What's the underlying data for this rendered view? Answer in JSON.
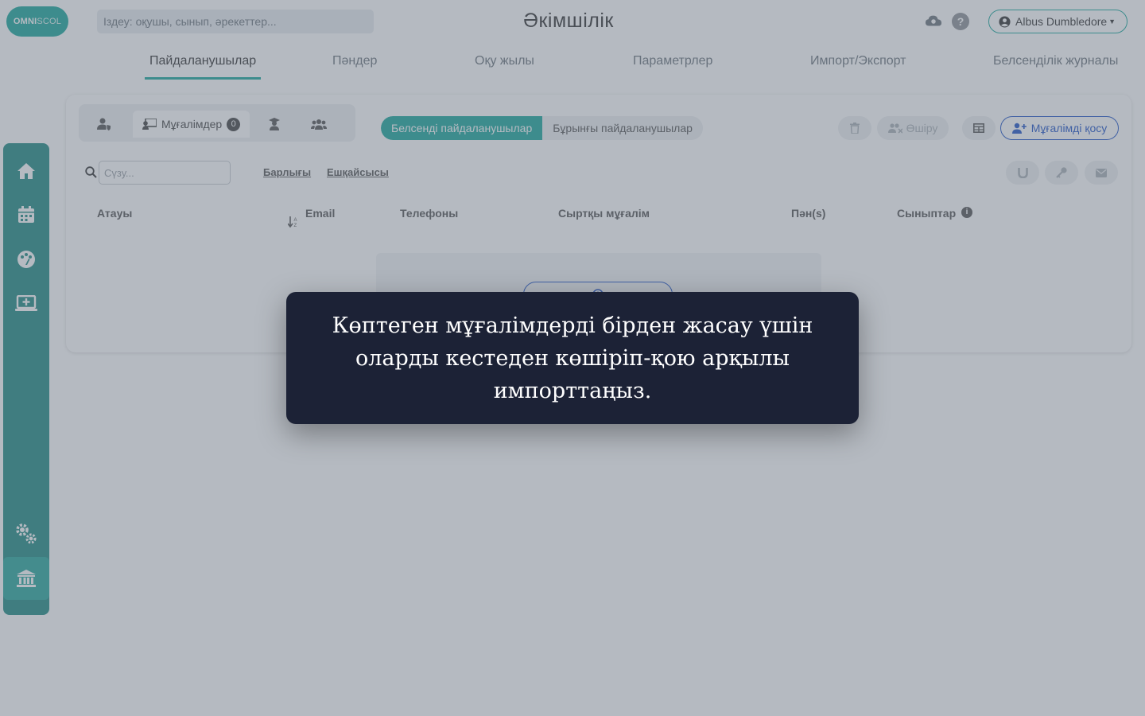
{
  "app": {
    "logo_text_bold": "OMNI",
    "logo_text_light": "SCOL",
    "page_title": "Әкімшілік",
    "search_placeholder": "Іздеу: оқушы, сынып, әрекеттер...",
    "user_name": "Albus Dumbledore"
  },
  "main_tabs": [
    {
      "label": "Пайдаланушылар",
      "active": true
    },
    {
      "label": "Пәндер",
      "active": false
    },
    {
      "label": "Оқу жылы",
      "active": false
    },
    {
      "label": "Параметрлер",
      "active": false
    },
    {
      "label": "Импорт/Экспорт",
      "active": false
    },
    {
      "label": "Белсенділік журналы",
      "active": false
    }
  ],
  "sidebar": {
    "items": [
      {
        "icon": "home-icon"
      },
      {
        "icon": "calendar-icon"
      },
      {
        "icon": "palette-icon"
      },
      {
        "icon": "laptop-icon"
      },
      {
        "icon": "cogs-icon"
      },
      {
        "icon": "institution-icon",
        "active": true
      }
    ]
  },
  "users": {
    "role_tabs": {
      "teachers_label": "Мұғалімдер",
      "teachers_count": "0"
    },
    "status_toggle": {
      "active_label": "Белсенді пайдаланушылар",
      "former_label": "Бұрынғы пайдаланушылар"
    },
    "delete_label": "Өшіру",
    "add_teacher_label": "Мұғалімді қосу",
    "filter_placeholder": "Сүзу...",
    "filter_all": "Барлығы",
    "filter_none": "Ешқайсысы",
    "columns": {
      "name": "Атауы",
      "email": "Email",
      "phone": "Телефоны",
      "external_teacher": "Сыртқы мұғалім",
      "subjects": "Пән(s)",
      "classes": "Сыныптар"
    }
  },
  "tooltip": {
    "text": "Көптеген мұғалімдерді бірден жасау үшін оларды кестеден көшіріп-қою арқылы импорттаңыз."
  },
  "colors": {
    "brand": "#1aa89c",
    "sidebar": "#1f8a82",
    "link_blue": "#2155c8",
    "tooltip_bg": "#1c2236"
  }
}
